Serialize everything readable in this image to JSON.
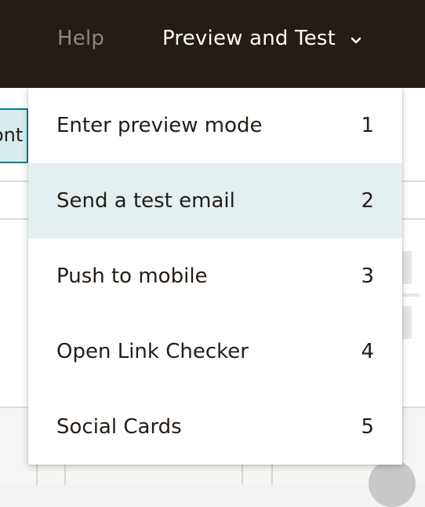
{
  "header": {
    "help_label": "Help",
    "preview_label": "Preview and Test",
    "preview_icon": "chevron-down-icon"
  },
  "background": {
    "content_button_fragment": "ont",
    "social_icon": "facebook-icon"
  },
  "menu": {
    "items": [
      {
        "label": "Enter preview mode",
        "shortcut": "1"
      },
      {
        "label": "Send a test email",
        "shortcut": "2"
      },
      {
        "label": "Push to mobile",
        "shortcut": "3"
      },
      {
        "label": "Open Link Checker",
        "shortcut": "4"
      },
      {
        "label": "Social Cards",
        "shortcut": "5"
      }
    ],
    "highlighted_index": 1
  },
  "colors": {
    "header_bg": "#241c15",
    "highlight_bg": "#e3eff1",
    "accent": "#007c89"
  }
}
